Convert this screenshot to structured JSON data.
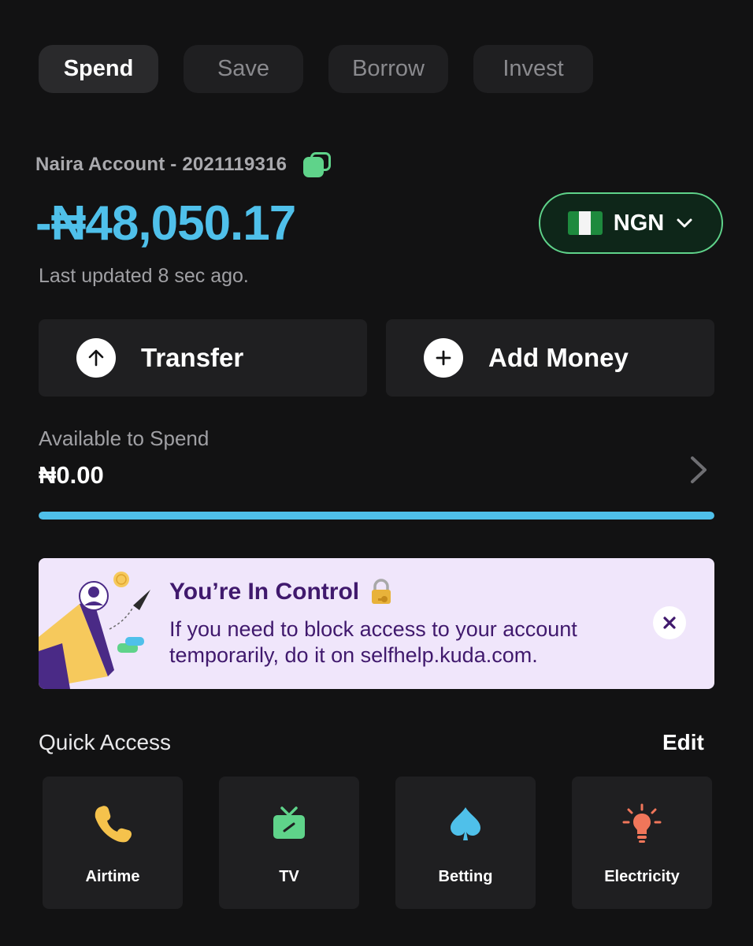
{
  "tabs": [
    {
      "label": "Spend",
      "active": true
    },
    {
      "label": "Save",
      "active": false
    },
    {
      "label": "Borrow",
      "active": false
    },
    {
      "label": "Invest",
      "active": false
    }
  ],
  "account": {
    "label": "Naira Account - 2021119316",
    "balance": "-₦48,050.17",
    "last_updated": "Last updated 8 sec ago.",
    "currency": {
      "code": "NGN",
      "flag": "nigeria-flag-icon"
    }
  },
  "actions": {
    "transfer_label": "Transfer",
    "add_money_label": "Add Money"
  },
  "available": {
    "label": "Available to Spend",
    "value": "₦0.00",
    "progress": 1.0
  },
  "banner": {
    "title": "You’re In Control",
    "text": "If you need to block access to your account temporarily, do it on selfhelp.kuda.com."
  },
  "quick_access": {
    "title": "Quick Access",
    "edit_label": "Edit",
    "items": [
      {
        "label": "Airtime",
        "icon": "phone-icon",
        "color": "#f5c24c"
      },
      {
        "label": "TV",
        "icon": "tv-icon",
        "color": "#5fd38a"
      },
      {
        "label": "Betting",
        "icon": "spade-icon",
        "color": "#4fc0ea"
      },
      {
        "label": "Electricity",
        "icon": "bulb-icon",
        "color": "#f0765a"
      }
    ]
  },
  "colors": {
    "accent_blue": "#4fc0ea",
    "accent_green": "#5fd38a",
    "banner_bg": "#f0e6fb",
    "banner_text": "#40196d"
  }
}
